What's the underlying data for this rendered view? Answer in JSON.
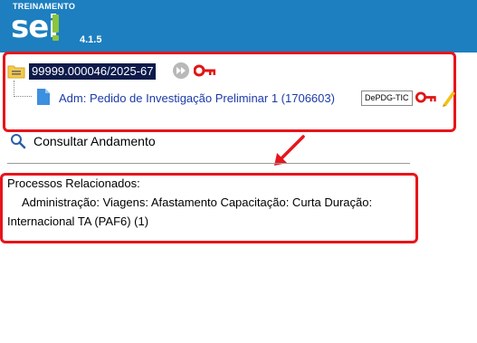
{
  "header": {
    "env_label": "TREINAMENTO",
    "logo_text": "sei",
    "version": "4.1.5"
  },
  "tree": {
    "process_number": "99999.000046/2025-67",
    "document_link": "Adm: Pedido de Investigação Preliminar 1 (1706603)",
    "unit_badge": "DePDG-TIC"
  },
  "actions": {
    "consultar_label": "Consultar Andamento"
  },
  "related": {
    "title": "Processos Relacionados:",
    "line1": "Administração: Viagens: Afastamento Capacitação: Curta Duração:",
    "line2": "Internacional TA (PAF6) (1)"
  },
  "icons": [
    "folder-icon",
    "fast-forward-icon",
    "key-icon",
    "document-icon",
    "pencil-icon",
    "search-icon",
    "arrow-annotation-icon"
  ],
  "colors": {
    "header_bg": "#1d7fbf",
    "logo_accent": "#8bc53f",
    "annotation_red": "#e8141b",
    "link_blue": "#1c3aa9",
    "selected_bg": "#0d1a4b"
  }
}
